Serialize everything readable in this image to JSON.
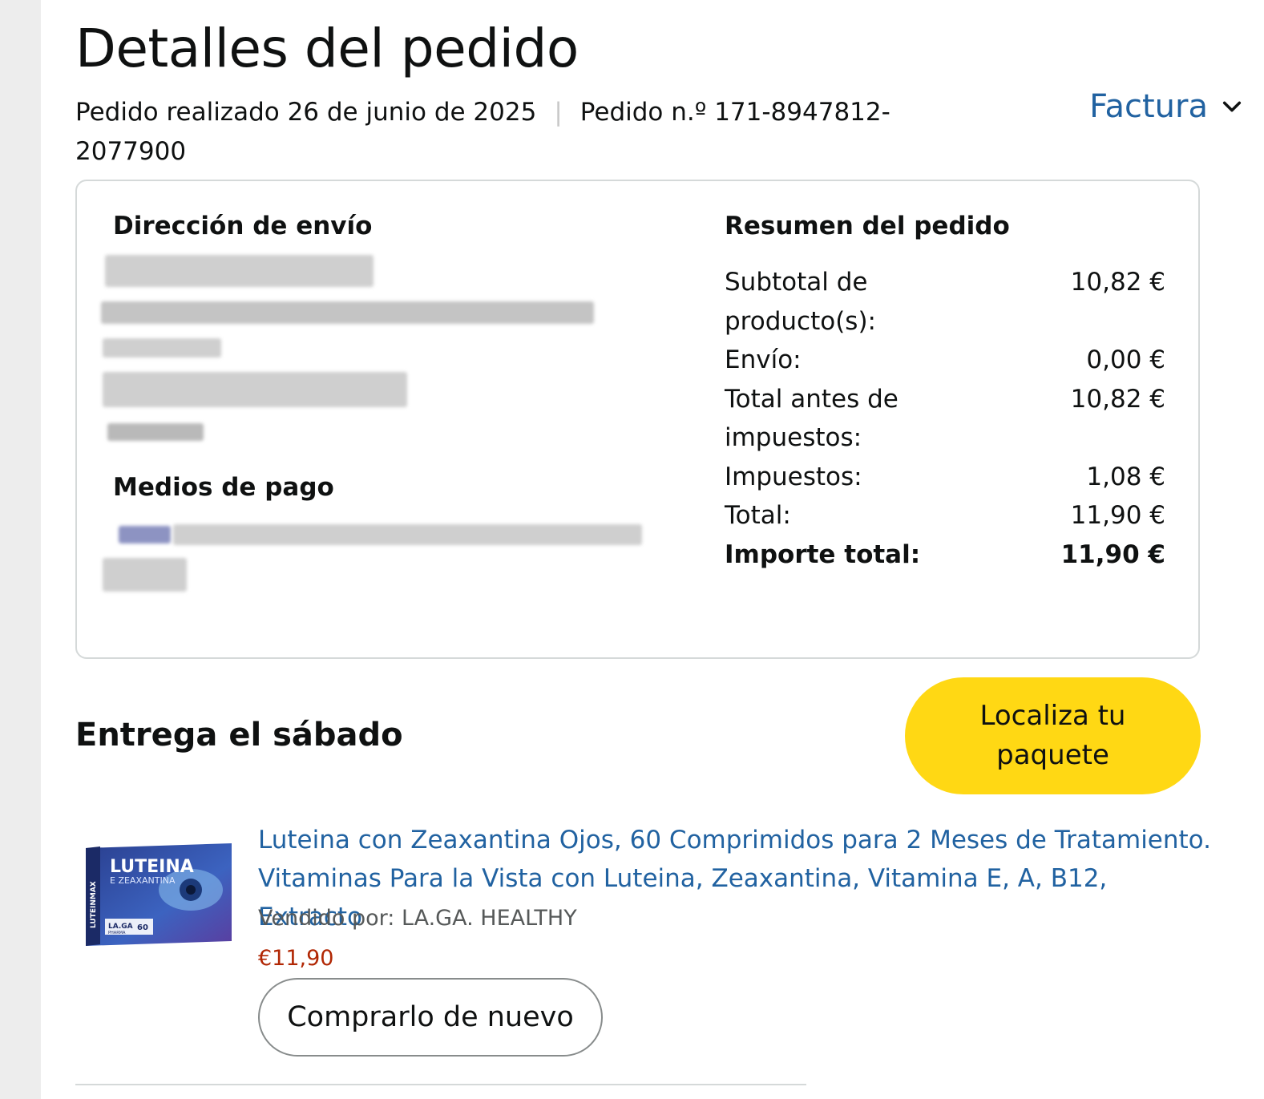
{
  "header": {
    "title": "Detalles del pedido",
    "order_date": "Pedido realizado 26 de junio de 2025",
    "separator": "|",
    "order_number": "Pedido n.º 171-8947812-2077900",
    "invoice_label": "Factura"
  },
  "shipping": {
    "heading": "Dirección de envío"
  },
  "payment": {
    "heading": "Medios de pago"
  },
  "summary": {
    "heading": "Resumen del pedido",
    "rows": [
      {
        "label": "Subtotal de producto(s):",
        "value": "10,82 €"
      },
      {
        "label": "Envío:",
        "value": "0,00 €"
      },
      {
        "label": "Total antes de impuestos:",
        "value": "10,82 €"
      },
      {
        "label": "Impuestos:",
        "value": "1,08 €"
      },
      {
        "label": "Total:",
        "value": "11,90 €"
      }
    ],
    "grand_total": {
      "label": "Importe total:",
      "value": "11,90 €"
    }
  },
  "delivery": {
    "heading": "Entrega el sábado",
    "track_button": "Localiza tu paquete"
  },
  "product": {
    "title": "Luteina con Zeaxantina Ojos, 60 Comprimidos para 2 Meses de Tratamiento. Vitaminas Para la Vista con Luteina, Zeaxantina, Vitamina E, A, B12, Extracto",
    "seller": "Vendido por: LA.GA. HEALTHY",
    "price": "€11,90",
    "buy_again": "Comprarlo de nuevo",
    "image": {
      "brand": "LUTEINA",
      "subtitle": "E ZEAXANTINA",
      "side_label": "LUTEINMAX",
      "maker": "LA.GA",
      "maker_sub": "PHARMA",
      "count": "60"
    }
  },
  "colors": {
    "link": "#2162a1",
    "track_button": "#ffd814",
    "price": "#b12704"
  }
}
